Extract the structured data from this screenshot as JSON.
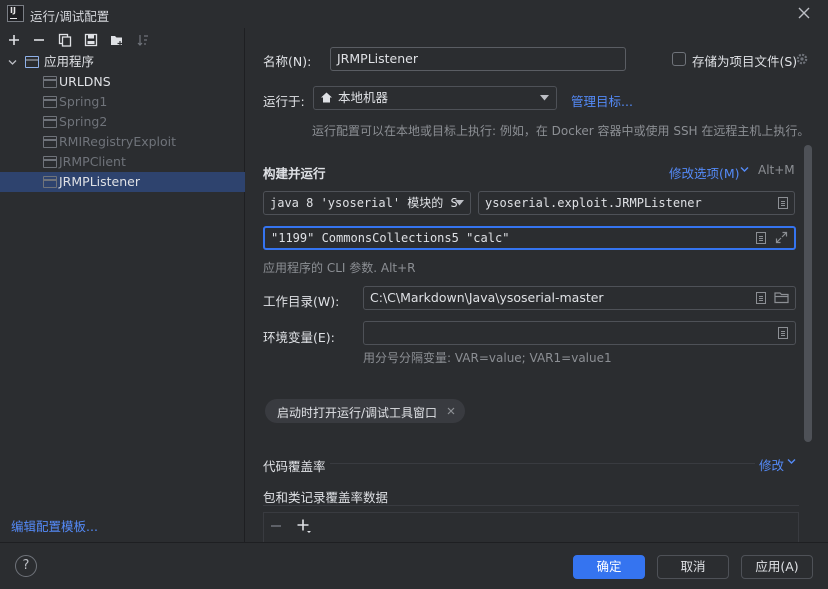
{
  "window": {
    "title": "运行/调试配置"
  },
  "sidebar": {
    "root_label": "应用程序",
    "items": [
      {
        "label": "URLDNS",
        "muted": false
      },
      {
        "label": "Spring1",
        "muted": true
      },
      {
        "label": "Spring2",
        "muted": true
      },
      {
        "label": "RMIRegistryExploit",
        "muted": true
      },
      {
        "label": "JRMPClient",
        "muted": true
      },
      {
        "label": "JRMPListener",
        "muted": false,
        "selected": true
      }
    ],
    "edit_template_link": "编辑配置模板..."
  },
  "form": {
    "name_label": "名称(N):",
    "name_value": "JRMPListener",
    "store_as_project_file_label": "存储为项目文件(S)",
    "run_on_label": "运行于:",
    "run_on_value": "本地机器",
    "manage_targets_link": "管理目标...",
    "run_on_hint": "运行配置可以在本地或目标上执行: 例如，在 Docker 容器中或使用 SSH 在远程主机上执行。",
    "build_run_title": "构建并运行",
    "modify_options_link": "修改选项(M)",
    "modify_options_shortcut": "Alt+M",
    "jdk_value": "java 8 'ysoserial' 模块的 S",
    "main_class_value": "ysoserial.exploit.JRMPListener",
    "program_args_value": "\"1199\" CommonsCollections5 \"calc\"",
    "program_args_hint": "应用程序的 CLI 参数. Alt+R",
    "workdir_label": "工作目录(W):",
    "workdir_value": "C:\\C\\Markdown\\Java\\ysoserial-master",
    "env_label": "环境变量(E):",
    "env_value": "",
    "env_hint": "用分号分隔变量: VAR=value; VAR1=value1",
    "chip_label": "启动时打开运行/调试工具窗口",
    "coverage_label": "代码覆盖率",
    "coverage_modify_link": "修改",
    "package_coverage_label": "包和类记录覆盖率数据"
  },
  "buttons": {
    "help": "?",
    "ok": "确定",
    "cancel": "取消",
    "apply": "应用(A)"
  },
  "colors": {
    "background": "#2b2d30",
    "accent": "#3574f0",
    "link": "#548af7",
    "selection": "#2e436e"
  }
}
